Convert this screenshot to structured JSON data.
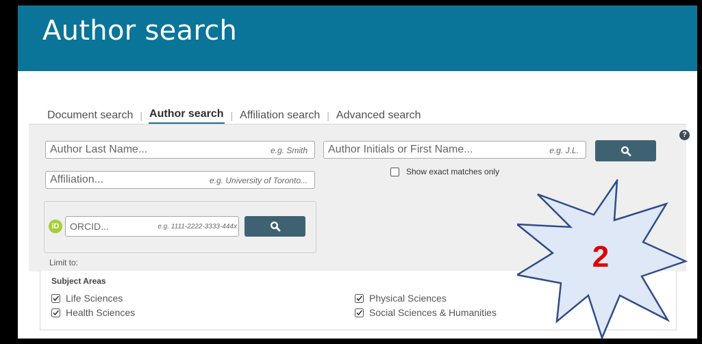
{
  "header": {
    "title": "Author search"
  },
  "tabs": [
    {
      "label": "Document search",
      "active": false
    },
    {
      "label": "Author search",
      "active": true
    },
    {
      "label": "Affiliation search",
      "active": false
    },
    {
      "label": "Advanced search",
      "active": false
    }
  ],
  "search": {
    "last_name": {
      "placeholder": "Author Last Name...",
      "example": "e.g. Smith"
    },
    "first_name": {
      "placeholder": "Author Initials or First Name...",
      "example": "e.g. J.L."
    },
    "affiliation": {
      "placeholder": "Affiliation...",
      "example": "e.g. University of Toronto..."
    },
    "orcid": {
      "placeholder": "ORCID...",
      "example": "e.g. 1111-2222-3333-444x"
    },
    "exact_matches_label": "Show exact matches only",
    "help": "?",
    "orcid_badge": "iD"
  },
  "limit": {
    "label": "Limit to:",
    "subject_title": "Subject Areas",
    "subjects": [
      {
        "label": "Life Sciences",
        "checked": true
      },
      {
        "label": "Health Sciences",
        "checked": true
      },
      {
        "label": "Physical Sciences",
        "checked": true
      },
      {
        "label": "Social Sciences & Humanities",
        "checked": true
      }
    ]
  },
  "annotation": {
    "number": "2",
    "color": "#e00000",
    "fill": "#dfe8f6",
    "stroke": "#2f4b8a"
  },
  "colors": {
    "header": "#0b7499",
    "button": "#3e6272",
    "orcid": "#a6ce39"
  },
  "icons": [
    "search-icon",
    "help-icon",
    "orcid-icon",
    "checkbox-icon"
  ]
}
